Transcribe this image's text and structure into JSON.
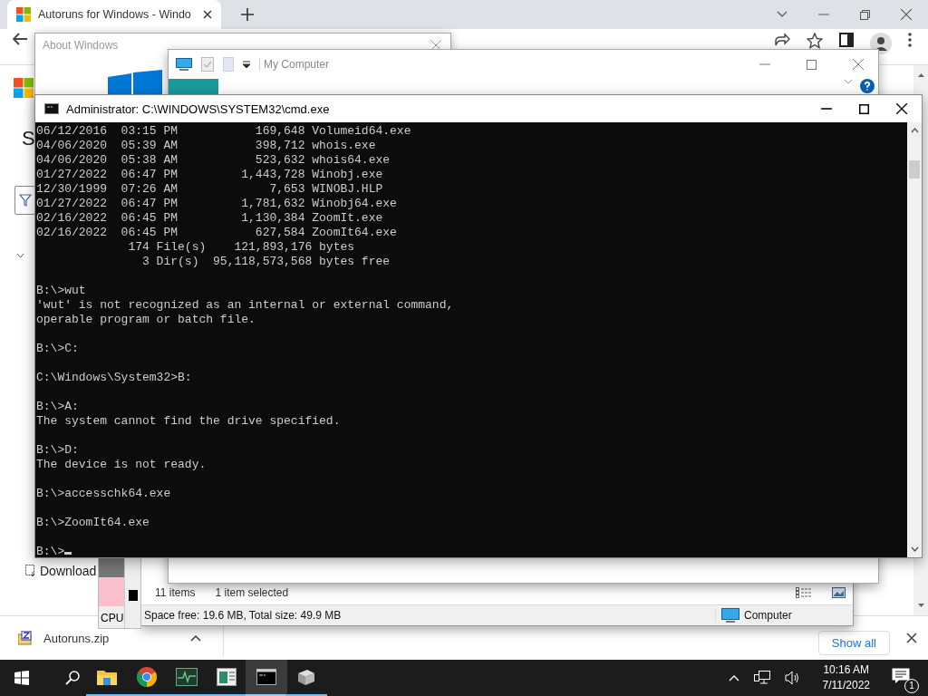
{
  "browser": {
    "tab": {
      "title": "Autoruns for Windows - Windo",
      "selected": true
    },
    "page": {
      "heading": "S",
      "link": "Download"
    },
    "download_bar": {
      "file": "Autoruns.zip",
      "show_all": "Show all"
    }
  },
  "about_dialog": {
    "title": "About Windows"
  },
  "explorer": {
    "title": "My Computer"
  },
  "explorer_status": {
    "items": "11 items",
    "selection": "1 item selected",
    "space": "Space free: 19.6 MB, Total size: 49.9 MB",
    "location": "Computer"
  },
  "task_manager": {
    "label": "CPU"
  },
  "console": {
    "title": "Administrator: C:\\WINDOWS\\SYSTEM32\\cmd.exe",
    "cursor": true,
    "blocks": [
      [
        "06/12/2016  03:15 PM           169,648 Volumeid64.exe",
        "04/06/2020  05:39 AM           398,712 whois.exe",
        "04/06/2020  05:38 AM           523,632 whois64.exe",
        "01/27/2022  06:47 PM         1,443,728 Winobj.exe",
        "12/30/1999  07:26 AM             7,653 WINOBJ.HLP",
        "01/27/2022  06:47 PM         1,781,632 Winobj64.exe",
        "02/16/2022  06:45 PM         1,130,384 ZoomIt.exe",
        "02/16/2022  06:45 PM           627,584 ZoomIt64.exe",
        "             174 File(s)    121,893,176 bytes",
        "               3 Dir(s)  95,118,573,568 bytes free"
      ],
      [
        "B:\\>wut",
        "'wut' is not recognized as an internal or external command,",
        "operable program or batch file."
      ],
      [
        "B:\\>C:"
      ],
      [
        "C:\\Windows\\System32>B:"
      ],
      [
        "B:\\>A:",
        "The system cannot find the drive specified."
      ],
      [
        "B:\\>D:",
        "The device is not ready."
      ],
      [
        "B:\\>accesschk64.exe"
      ],
      [
        "B:\\>ZoomIt64.exe"
      ],
      [
        "B:\\>"
      ]
    ]
  },
  "taskbar": {
    "apps": [
      {
        "kind": "explorer",
        "selected": false
      },
      {
        "kind": "chrome",
        "selected": false
      },
      {
        "kind": "monitor",
        "selected": false
      },
      {
        "kind": "form",
        "selected": false
      },
      {
        "kind": "console",
        "selected": true
      },
      {
        "kind": "package",
        "selected": false
      }
    ],
    "time": "10:16 AM",
    "date": "7/11/2022",
    "notifications": "1"
  }
}
